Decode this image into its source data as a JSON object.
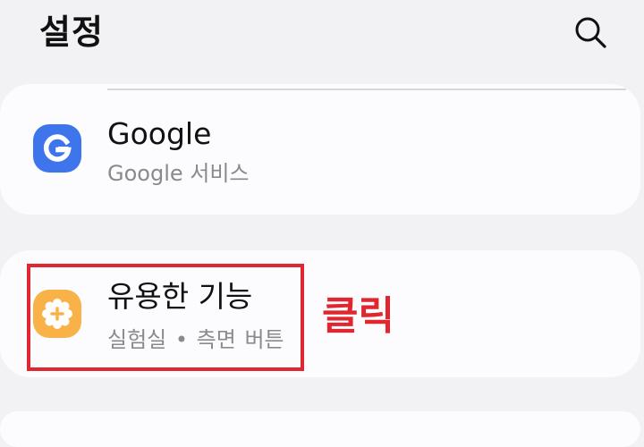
{
  "header": {
    "title": "설정",
    "search_icon": "search-icon"
  },
  "items": [
    {
      "title": "Google",
      "subtitle": "Google 서비스",
      "icon": "google-g-icon",
      "icon_color": "#3e75ec"
    },
    {
      "title": "유용한 기능",
      "subtitle": "실험실 • 측면 버튼",
      "icon": "gear-plus-icon",
      "icon_color": "#f9b247"
    }
  ],
  "annotation": {
    "label": "클릭",
    "color": "#e0262e"
  }
}
